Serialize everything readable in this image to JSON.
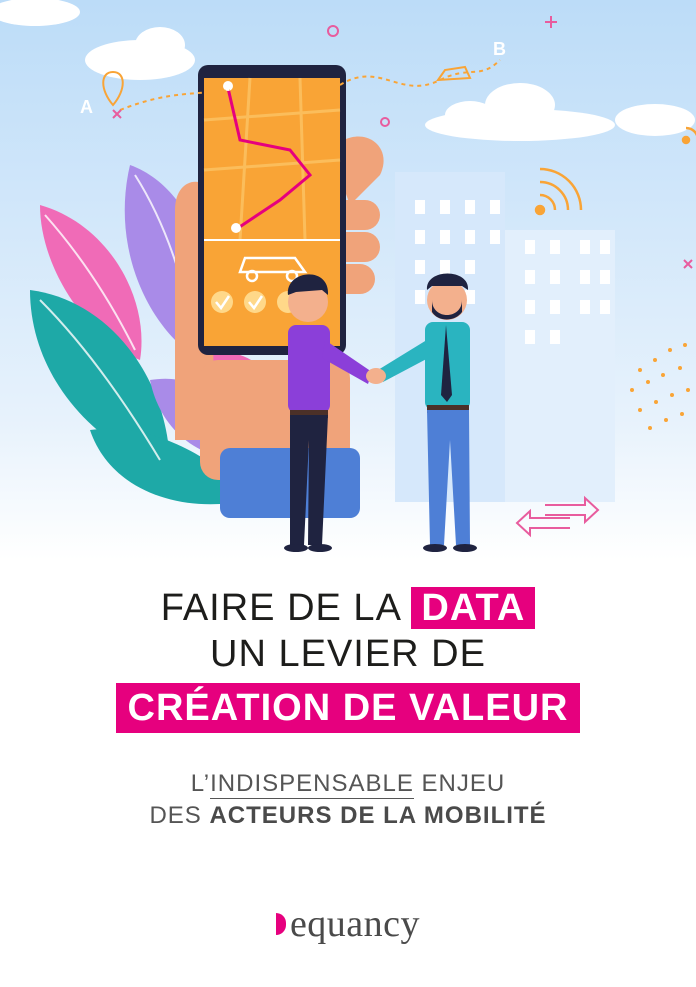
{
  "illustration": {
    "map_label_a": "A",
    "map_label_b": "B",
    "icons": [
      "phone-icon",
      "map-pin-icon",
      "car-icon",
      "wifi-signal-icon",
      "check-icon",
      "swap-arrows-icon",
      "building-icon",
      "cloud-icon"
    ]
  },
  "title": {
    "line1_prefix": "FAIRE DE LA ",
    "line1_highlight": "DATA",
    "line2": "UN LEVIER DE",
    "line3_highlight": "CRÉATION DE VALEUR"
  },
  "subtitle": {
    "line1_prefix": "L’",
    "line1_underlined": "INDISPENSABLE",
    "line1_suffix": " ENJEU",
    "line2_prefix": "DES ",
    "line2_bold": "ACTEURS DE LA MOBILITÉ"
  },
  "brand": {
    "name": "equancy",
    "accent": "#e6007e"
  },
  "colors": {
    "accent": "#e6007e",
    "sky": "#cfe6fb",
    "text": "#1d1d1b"
  }
}
